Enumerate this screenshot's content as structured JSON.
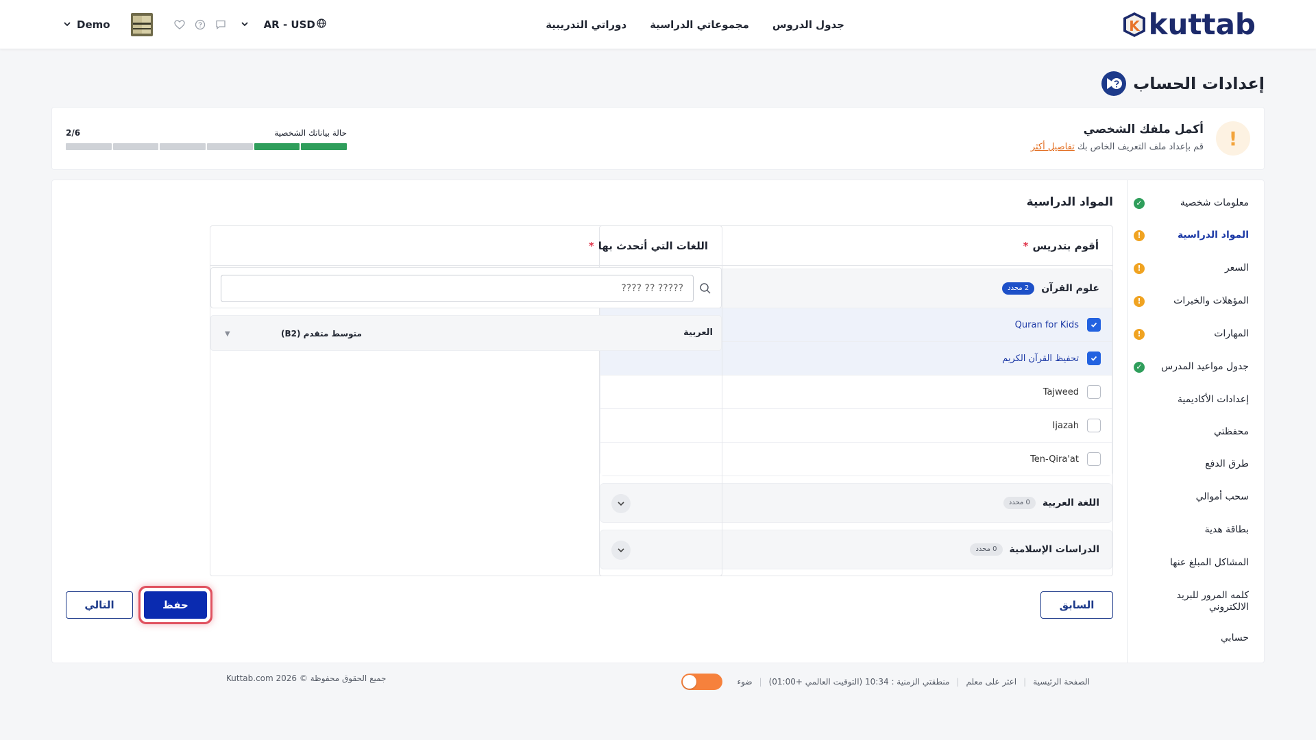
{
  "header": {
    "logo_text": "kuttab",
    "logo_letter": "K",
    "nav": [
      "جدول الدروس",
      "مجموعاتي الدراسية",
      "دوراتي التدريبية"
    ],
    "user_name": "Demo",
    "locale": "AR - USD"
  },
  "page": {
    "title": "إعدادات الحساب"
  },
  "profile": {
    "title": "أكمل ملفك الشخصي",
    "subtitle": "قم بإعداد ملف التعريف الخاص بك",
    "details_link": "تفاصيل أكثر",
    "status_label": "حالة بياناتك الشخصية",
    "progress_text": "2/6",
    "progress_done": 2,
    "progress_total": 6
  },
  "sidebar": {
    "items": [
      {
        "label": "معلومات شخصية",
        "status": "ok"
      },
      {
        "label": "المواد الدراسية",
        "status": "warn",
        "active": true
      },
      {
        "label": "السعر",
        "status": "warn"
      },
      {
        "label": "المؤهلات والخبرات",
        "status": "warn"
      },
      {
        "label": "المهارات",
        "status": "warn"
      },
      {
        "label": "جدول مواعيد المدرس",
        "status": "ok"
      },
      {
        "label": "إعدادات الأكاديمية",
        "status": ""
      },
      {
        "label": "محفظتي",
        "status": ""
      },
      {
        "label": "طرق الدفع",
        "status": ""
      },
      {
        "label": "سحب أموالي",
        "status": ""
      },
      {
        "label": "بطاقة هدية",
        "status": ""
      },
      {
        "label": "المشاكل المبلغ عنها",
        "status": ""
      },
      {
        "label": "كلمه المرور للبريد الالكتروني",
        "status": ""
      },
      {
        "label": "حسابي",
        "status": ""
      }
    ]
  },
  "subjects": {
    "section_title": "المواد الدراسية",
    "teach_label": "أقوم بتدريس",
    "required_mark": "*",
    "categories": [
      {
        "title": "علوم القرآن",
        "badge": "2 محدد",
        "expanded": true,
        "items": [
          {
            "label": "Quran for Kids",
            "checked": true
          },
          {
            "label": "تحفيظ القرآن الكريم",
            "checked": true
          },
          {
            "label": "Tajweed",
            "checked": false
          },
          {
            "label": "Ijazah",
            "checked": false
          },
          {
            "label": "Ten-Qira'at",
            "checked": false
          }
        ]
      },
      {
        "title": "اللغة العربية",
        "badge": "0 محدد",
        "expanded": false
      },
      {
        "title": "الدراسات الإسلامية",
        "badge": "0 محدد",
        "expanded": false
      }
    ]
  },
  "languages": {
    "label": "اللغات التي أتحدث بها",
    "search_placeholder": "????? ?? ????",
    "rows": [
      {
        "name": "العربية",
        "level": "متوسط متقدم (B2)"
      }
    ]
  },
  "buttons": {
    "prev": "السابق",
    "save": "حفظ",
    "next": "التالي"
  },
  "footer": {
    "home": "الصفحة الرئيسية",
    "find_teacher": "اعثر على معلم",
    "timezone": "منطقتي الزمنية : 10:34 (التوقيت العالمي +01:00)",
    "light": "ضوء",
    "copyright": "جميع الحقوق محفوظة © 2026 Kuttab.com"
  },
  "colors": {
    "brand": "#1c2a6b",
    "primary": "#0a2bb0",
    "ok": "#2f9e5b",
    "warn": "#f0a321",
    "accent": "#f6813c"
  }
}
